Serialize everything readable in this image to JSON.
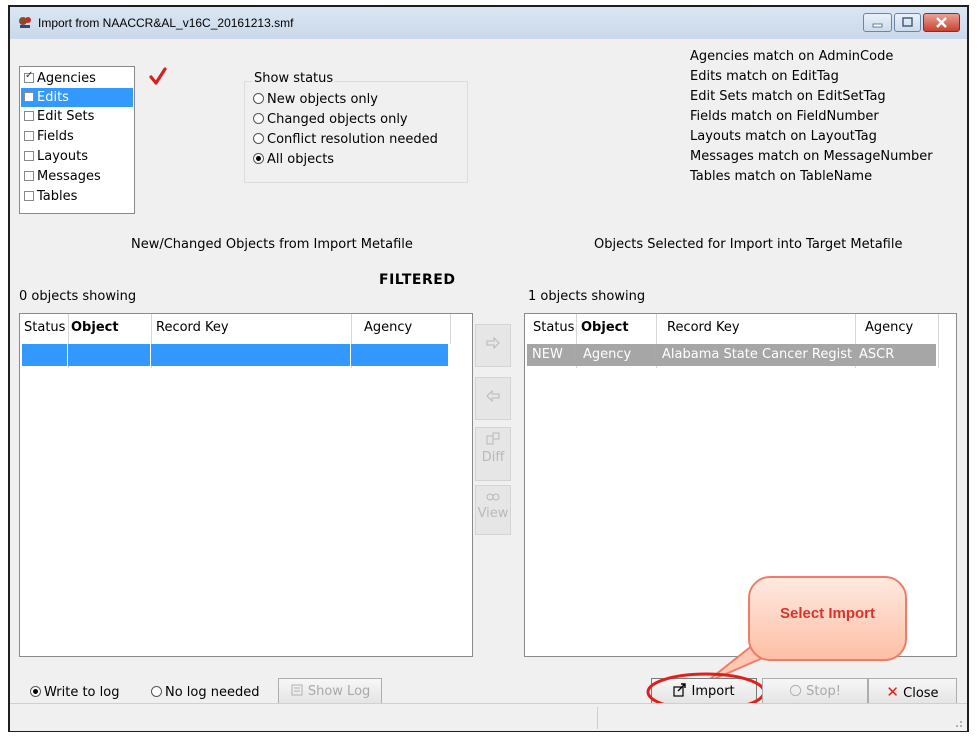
{
  "window": {
    "title": "Import from NAACCR&AL_v16C_20161213.smf"
  },
  "object_types": [
    {
      "label": "Agencies",
      "checked": true,
      "selected": false
    },
    {
      "label": "Edits",
      "checked": false,
      "selected": true
    },
    {
      "label": "Edit Sets",
      "checked": false,
      "selected": false
    },
    {
      "label": "Fields",
      "checked": false,
      "selected": false
    },
    {
      "label": "Layouts",
      "checked": false,
      "selected": false
    },
    {
      "label": "Messages",
      "checked": false,
      "selected": false
    },
    {
      "label": "Tables",
      "checked": false,
      "selected": false
    }
  ],
  "show_status": {
    "legend": "Show status",
    "options": [
      {
        "label": "New objects only",
        "selected": false
      },
      {
        "label": "Changed objects only",
        "selected": false
      },
      {
        "label": "Conflict resolution needed",
        "selected": false
      },
      {
        "label": "All objects",
        "selected": true
      }
    ]
  },
  "match_rules": [
    "Agencies match on AdminCode",
    "Edits match on EditTag",
    "Edit Sets match on EditSetTag",
    "Fields match on FieldNumber",
    "Layouts match on LayoutTag",
    "Messages match on MessageNumber",
    "Tables match on TableName"
  ],
  "left_panel": {
    "heading": "New/Changed Objects from Import Metafile",
    "count_text": "0 objects showing",
    "columns": [
      "Status",
      "Object",
      "Record Key",
      "Agency"
    ]
  },
  "filtered_label": "FILTERED",
  "right_panel": {
    "heading": "Objects Selected for Import into Target Metafile",
    "count_text": "1 objects showing",
    "columns": [
      "Status",
      "Object",
      "Record Key",
      "Agency"
    ],
    "rows": [
      {
        "status": "NEW",
        "object": "Agency",
        "record_key": "Alabama State Cancer Regist",
        "agency": "ASCR"
      }
    ]
  },
  "middle_buttons": {
    "add_icon": "right-arrow-icon",
    "remove_icon": "left-arrow-icon",
    "diff_label": "Diff",
    "view_label": "View"
  },
  "bottom": {
    "write_log": "Write to log",
    "no_log": "No log needed",
    "show_log": "Show Log",
    "import": "Import",
    "stop": "Stop!",
    "close": "Close"
  },
  "callout": "Select Import",
  "colors": {
    "selection": "#3399ff",
    "selected_row": "#a0a0a0",
    "callout_red": "#d9342b",
    "close_x": "#e0201c"
  }
}
